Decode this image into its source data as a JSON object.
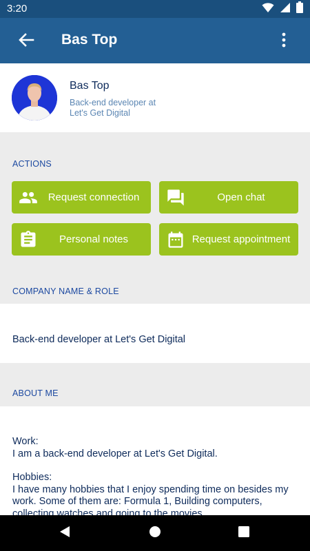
{
  "status_bar": {
    "time": "3:20"
  },
  "app_bar": {
    "title": "Bas Top"
  },
  "profile": {
    "name": "Bas Top",
    "role": "Back-end developer at Let's Get Digital"
  },
  "sections": {
    "actions": "ACTIONS",
    "company": "COMPANY NAME & ROLE",
    "about": "ABOUT ME"
  },
  "actions": {
    "request_connection": "Request connection",
    "open_chat": "Open chat",
    "personal_notes": "Personal notes",
    "request_appointment": "Request appointment"
  },
  "company": {
    "text": "Back-end developer at Let's Get Digital"
  },
  "about": {
    "work_title": "Work:",
    "work_text": "I am a back-end developer at Let's Get Digital.",
    "hobbies_title": "Hobbies:",
    "hobbies_text": "I have many hobbies that I enjoy spending time on besides my work. Some of them are: Formula 1, Building computers, collecting watches and going to the movies."
  },
  "colors": {
    "app_bar": "#235f94",
    "status_bar": "#1a4f7d",
    "action_button": "#9bc31e",
    "section_label": "#1b48a0",
    "section_bg": "#ececec"
  }
}
